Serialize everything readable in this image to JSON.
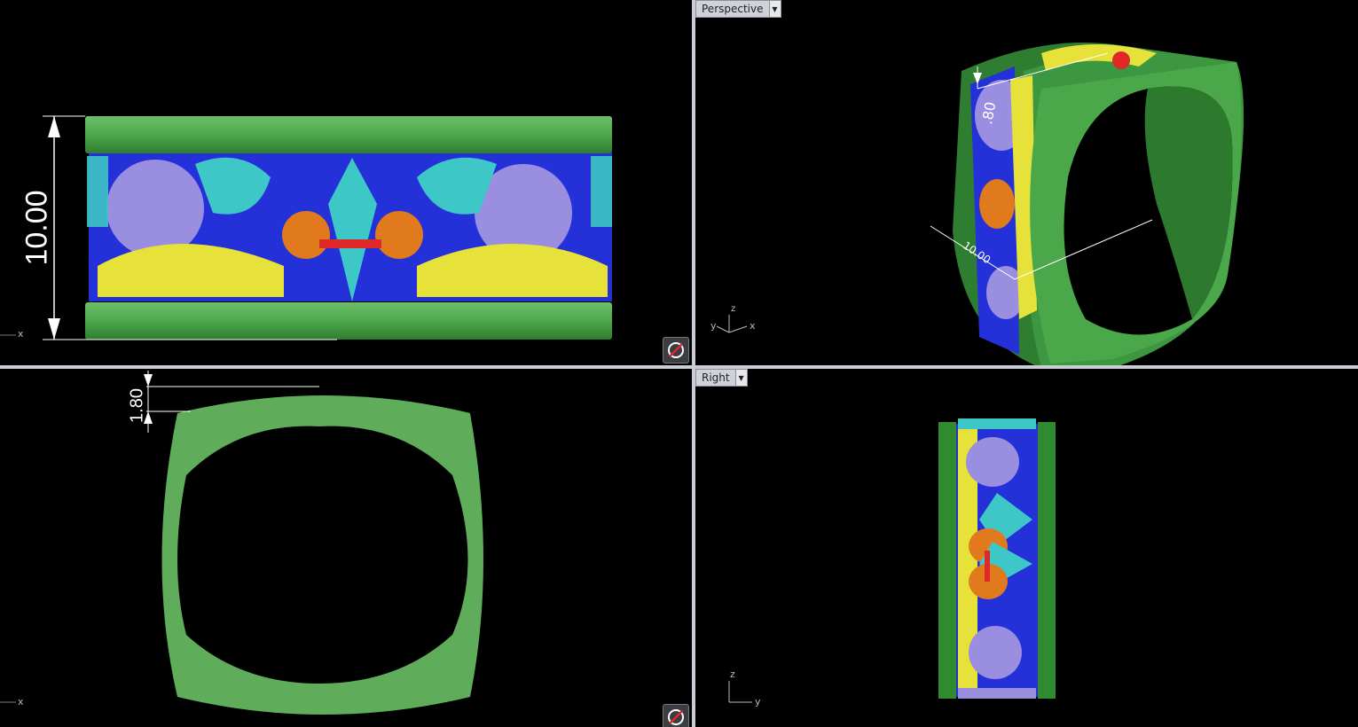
{
  "viewports": {
    "top_left": {
      "dimension": "10.00",
      "axis_x": "x"
    },
    "top_right": {
      "name": "Perspective",
      "dimension_small": ".80",
      "dimension_large": "10.00",
      "axis_x": "x",
      "axis_y": "y",
      "axis_z": "z"
    },
    "bottom_left": {
      "dimension": "1.80",
      "axis_x": "x"
    },
    "bottom_right": {
      "name": "Right",
      "axis_y": "y",
      "axis_z": "z"
    }
  },
  "colors": {
    "band_green": "#3f9a3f",
    "band_green_light": "#6cbf6a",
    "fill_blue": "#2430d8",
    "purple": "#9a8ee0",
    "teal": "#3ec7c7",
    "yellow": "#e6e23a",
    "orange": "#e07a1c",
    "red": "#e02828",
    "viewport_bg": "#000000",
    "divider": "#c9cdd3"
  },
  "icons": {
    "nav_button": "rotate-view-icon",
    "dropdown": "chevron-down-icon"
  }
}
